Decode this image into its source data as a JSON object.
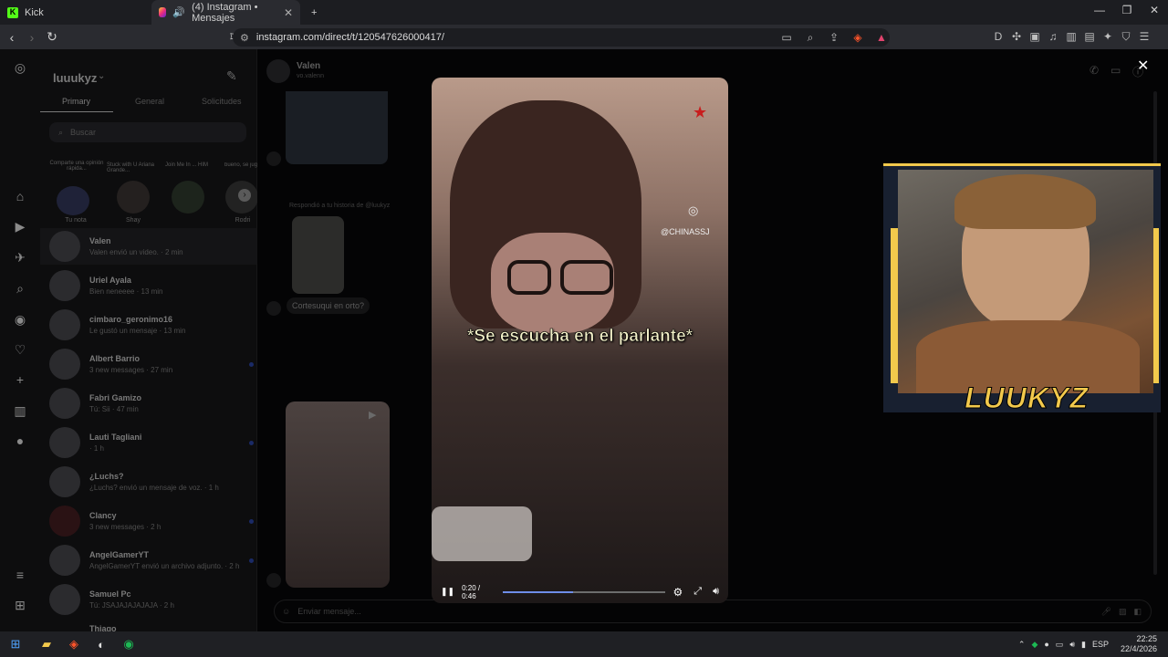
{
  "tabs": [
    {
      "icon": "kick-icon",
      "label": "Kick"
    },
    {
      "icon": "instagram-icon",
      "label": "(4) Instagram • Mensajes"
    }
  ],
  "address": "instagram.com/direct/t/120547626000417/",
  "sidebar": {
    "username": "luuukyz",
    "tabs": [
      "Primary",
      "General",
      "Solicitudes"
    ],
    "search_placeholder": "Buscar",
    "notes": [
      {
        "text": "Comparte una opinión rápida...",
        "label": "Tu nota"
      },
      {
        "text": "Stuck with U Ariana Grande...",
        "label": "Shay"
      },
      {
        "text": "Join Me In ... HIM",
        "label": ""
      },
      {
        "text": "bueno, se jugara otro mixto",
        "label": "Rodri"
      }
    ],
    "conversations": [
      {
        "name": "Valen",
        "message": "Valen envió un video. · 2 min"
      },
      {
        "name": "Uriel Ayala",
        "message": "Bien neneeee · 13 min"
      },
      {
        "name": "cimbaro_geronimo16",
        "message": "Le gustó un mensaje · 13 min"
      },
      {
        "name": "Albert Barrio",
        "message": "3 new messages · 27 min"
      },
      {
        "name": "Fabri Gamizo",
        "message": "Tú: Sii · 47 min"
      },
      {
        "name": "Lauti Tagliani",
        "message": "· 1 h"
      },
      {
        "name": "¿Luchs?",
        "message": "¿Luchs? envió un mensaje de voz. · 1 h"
      },
      {
        "name": "Clancy",
        "message": "3 new messages · 2 h"
      },
      {
        "name": "AngelGamerYT",
        "message": "AngelGamerYT envió un archivo adjunto. · 2 h"
      },
      {
        "name": "Samuel Pc",
        "message": "Tú: JSAJAJAJAJAJA · 2 h"
      },
      {
        "name": "Thiago",
        "message": ""
      }
    ]
  },
  "chat": {
    "contact": "Valen",
    "handle": "vo.valenn",
    "story_reply": "Respondió a tu historia de @luukyz",
    "bubble": "Cortesuqui en orto?",
    "composer_placeholder": "Enviar mensaje..."
  },
  "video": {
    "caption": "*Se escucha en el parlante*",
    "watermark": "@CHINASSJ",
    "time": "0:20 / 0:46",
    "progress": 0.43
  },
  "streamer": {
    "name": "LUUKYZ"
  },
  "taskbar": {
    "lang": "ESP",
    "time": "22:25",
    "date": "22/4/2026"
  }
}
